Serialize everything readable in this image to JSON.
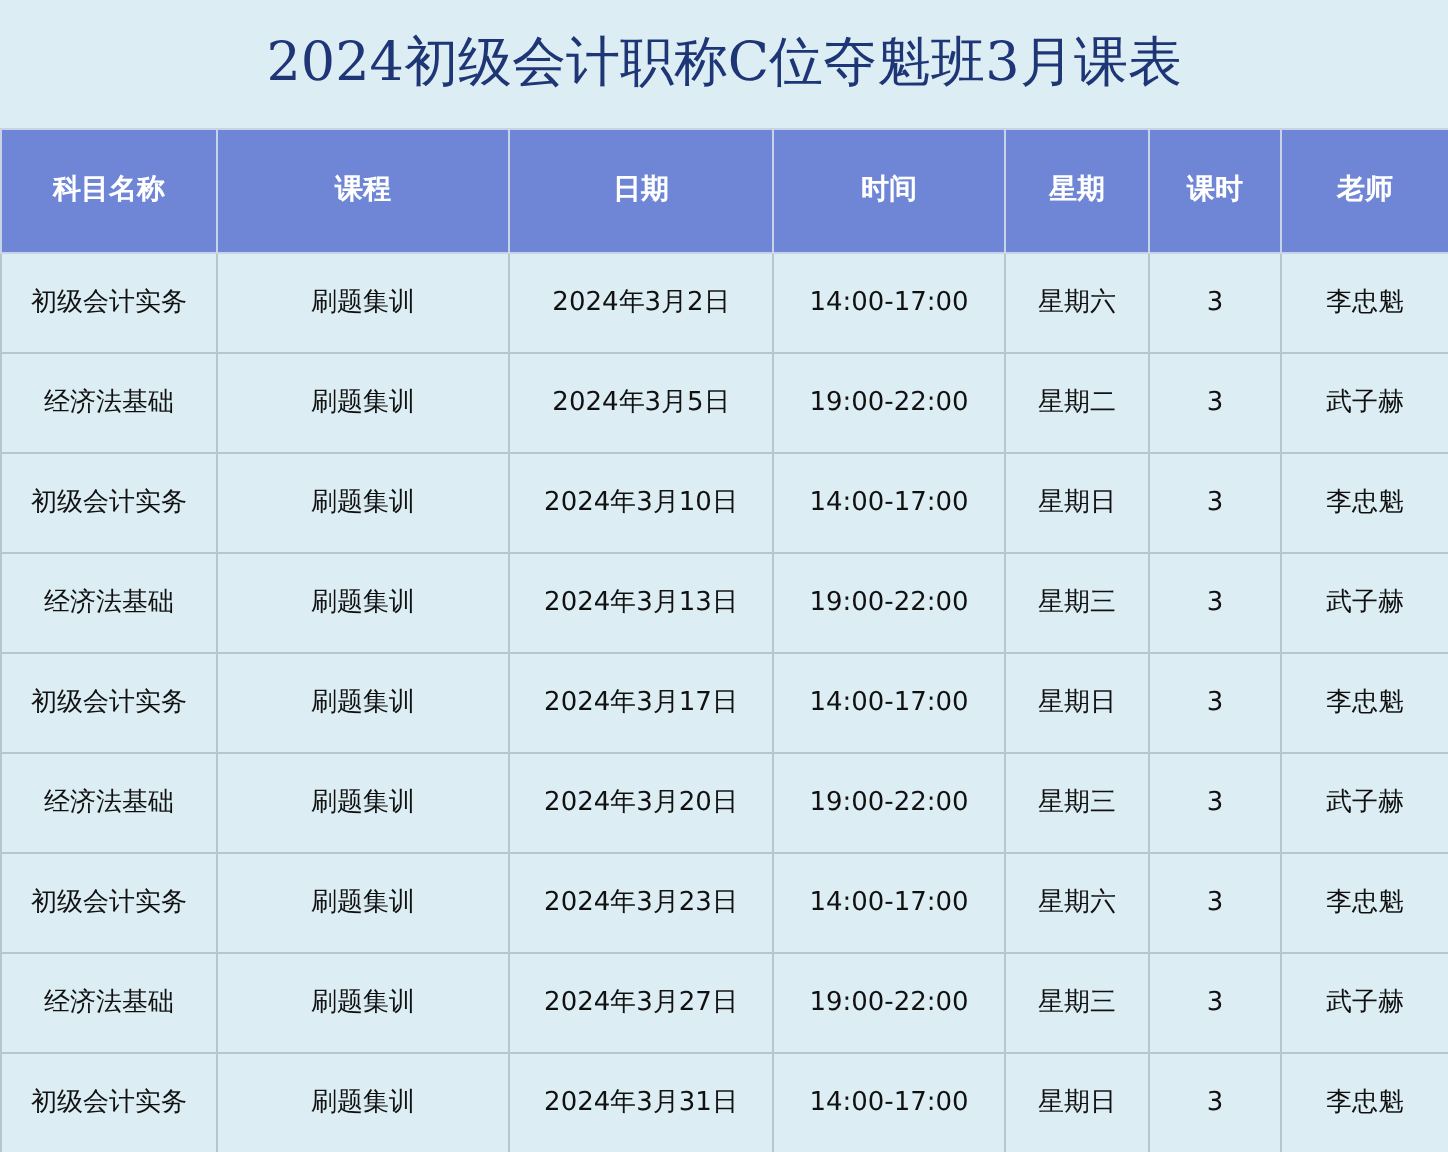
{
  "title": "2024初级会计职称C位夺魁班3月课表",
  "table": {
    "columns": [
      "科目名称",
      "课程",
      "日期",
      "时间",
      "星期",
      "课时",
      "老师"
    ],
    "rows": [
      [
        "初级会计实务",
        "刷题集训",
        "2024年3月2日",
        "14:00-17:00",
        "星期六",
        "3",
        "李忠魁"
      ],
      [
        "经济法基础",
        "刷题集训",
        "2024年3月5日",
        "19:00-22:00",
        "星期二",
        "3",
        "武子赫"
      ],
      [
        "初级会计实务",
        "刷题集训",
        "2024年3月10日",
        "14:00-17:00",
        "星期日",
        "3",
        "李忠魁"
      ],
      [
        "经济法基础",
        "刷题集训",
        "2024年3月13日",
        "19:00-22:00",
        "星期三",
        "3",
        "武子赫"
      ],
      [
        "初级会计实务",
        "刷题集训",
        "2024年3月17日",
        "14:00-17:00",
        "星期日",
        "3",
        "李忠魁"
      ],
      [
        "经济法基础",
        "刷题集训",
        "2024年3月20日",
        "19:00-22:00",
        "星期三",
        "3",
        "武子赫"
      ],
      [
        "初级会计实务",
        "刷题集训",
        "2024年3月23日",
        "14:00-17:00",
        "星期六",
        "3",
        "李忠魁"
      ],
      [
        "经济法基础",
        "刷题集训",
        "2024年3月27日",
        "19:00-22:00",
        "星期三",
        "3",
        "武子赫"
      ],
      [
        "初级会计实务",
        "刷题集训",
        "2024年3月31日",
        "14:00-17:00",
        "星期日",
        "3",
        "李忠魁"
      ]
    ]
  }
}
